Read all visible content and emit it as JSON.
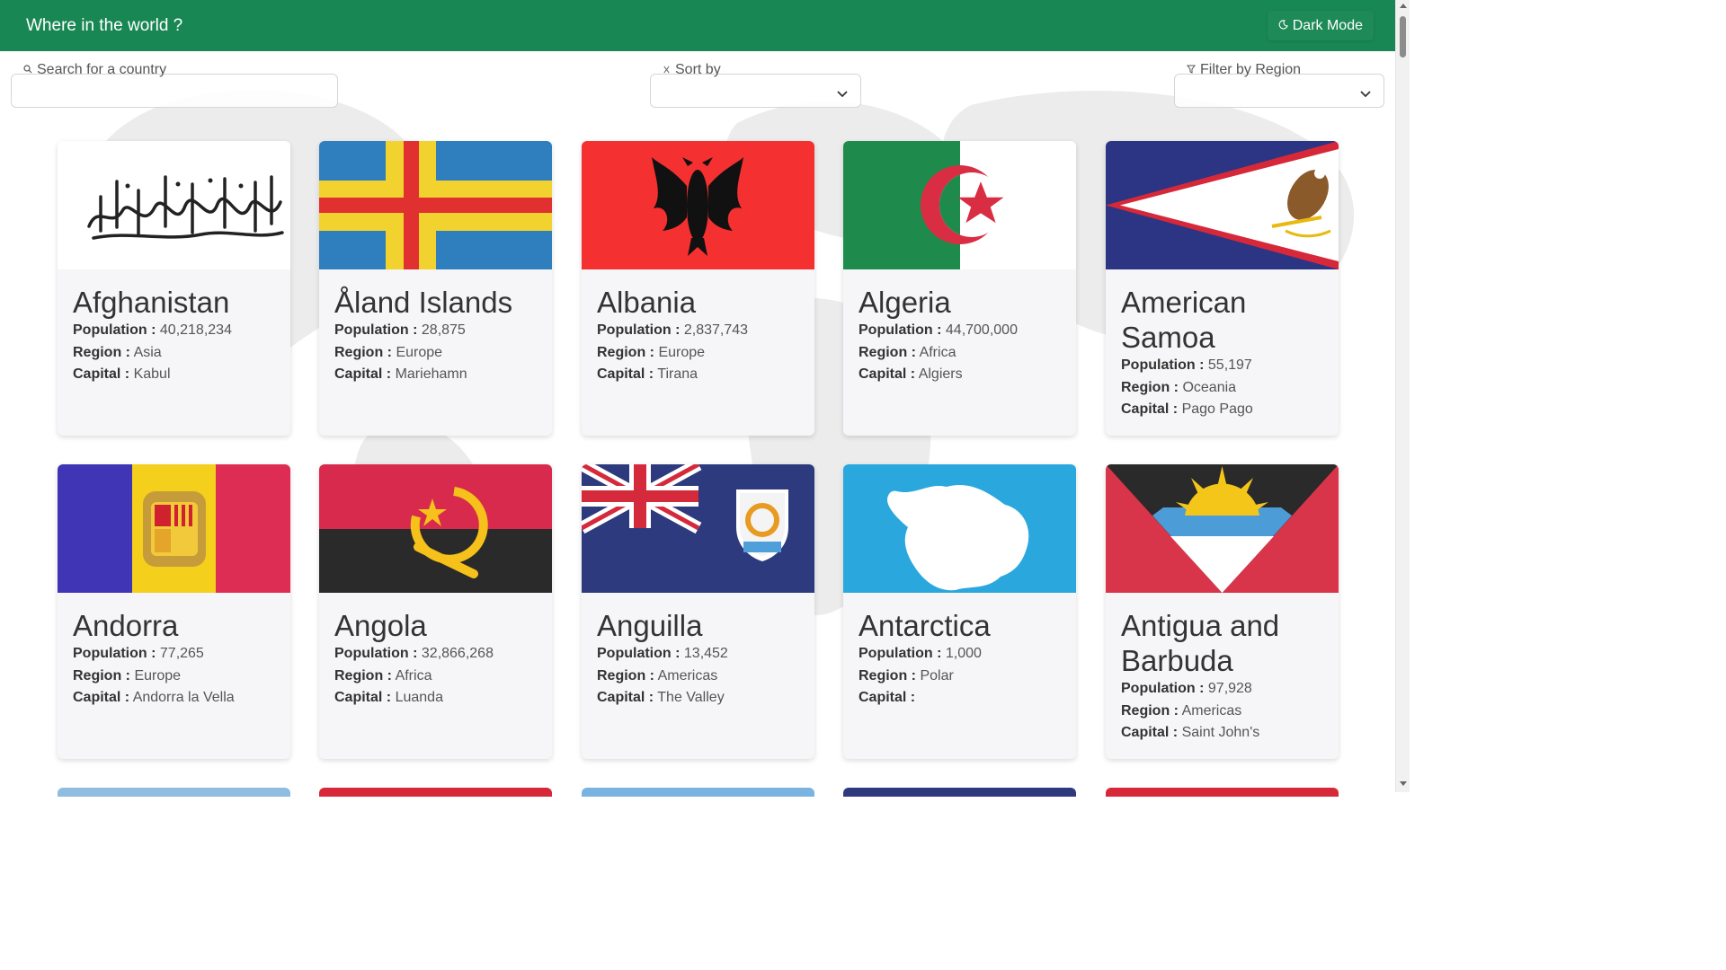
{
  "header": {
    "title": "Where in the world ?",
    "dark_mode_label": "Dark Mode"
  },
  "controls": {
    "search_label": "Search for a country",
    "sort_label": "Sort by",
    "filter_label": "Filter by Region"
  },
  "labels": {
    "population": "Population :",
    "region": "Region :",
    "capital": "Capital :"
  },
  "countries": [
    {
      "name": "Afghanistan",
      "population": "40,218,234",
      "region": "Asia",
      "capital": "Kabul"
    },
    {
      "name": "Åland Islands",
      "population": "28,875",
      "region": "Europe",
      "capital": "Mariehamn"
    },
    {
      "name": "Albania",
      "population": "2,837,743",
      "region": "Europe",
      "capital": "Tirana"
    },
    {
      "name": "Algeria",
      "population": "44,700,000",
      "region": "Africa",
      "capital": "Algiers"
    },
    {
      "name": "American Samoa",
      "population": "55,197",
      "region": "Oceania",
      "capital": "Pago Pago"
    },
    {
      "name": "Andorra",
      "population": "77,265",
      "region": "Europe",
      "capital": "Andorra la Vella"
    },
    {
      "name": "Angola",
      "population": "32,866,268",
      "region": "Africa",
      "capital": "Luanda"
    },
    {
      "name": "Anguilla",
      "population": "13,452",
      "region": "Americas",
      "capital": "The Valley"
    },
    {
      "name": "Antarctica",
      "population": "1,000",
      "region": "Polar",
      "capital": ""
    },
    {
      "name": "Antigua and Barbuda",
      "population": "97,928",
      "region": "Americas",
      "capital": "Saint John's"
    }
  ],
  "icons": {
    "search": "search-icon",
    "sort": "sort-icon",
    "filter": "funnel-icon",
    "moon": "moon-icon",
    "chevron": "chevron-down-icon"
  },
  "colors": {
    "navbar": "#198754",
    "card": "#f6f6f8"
  }
}
